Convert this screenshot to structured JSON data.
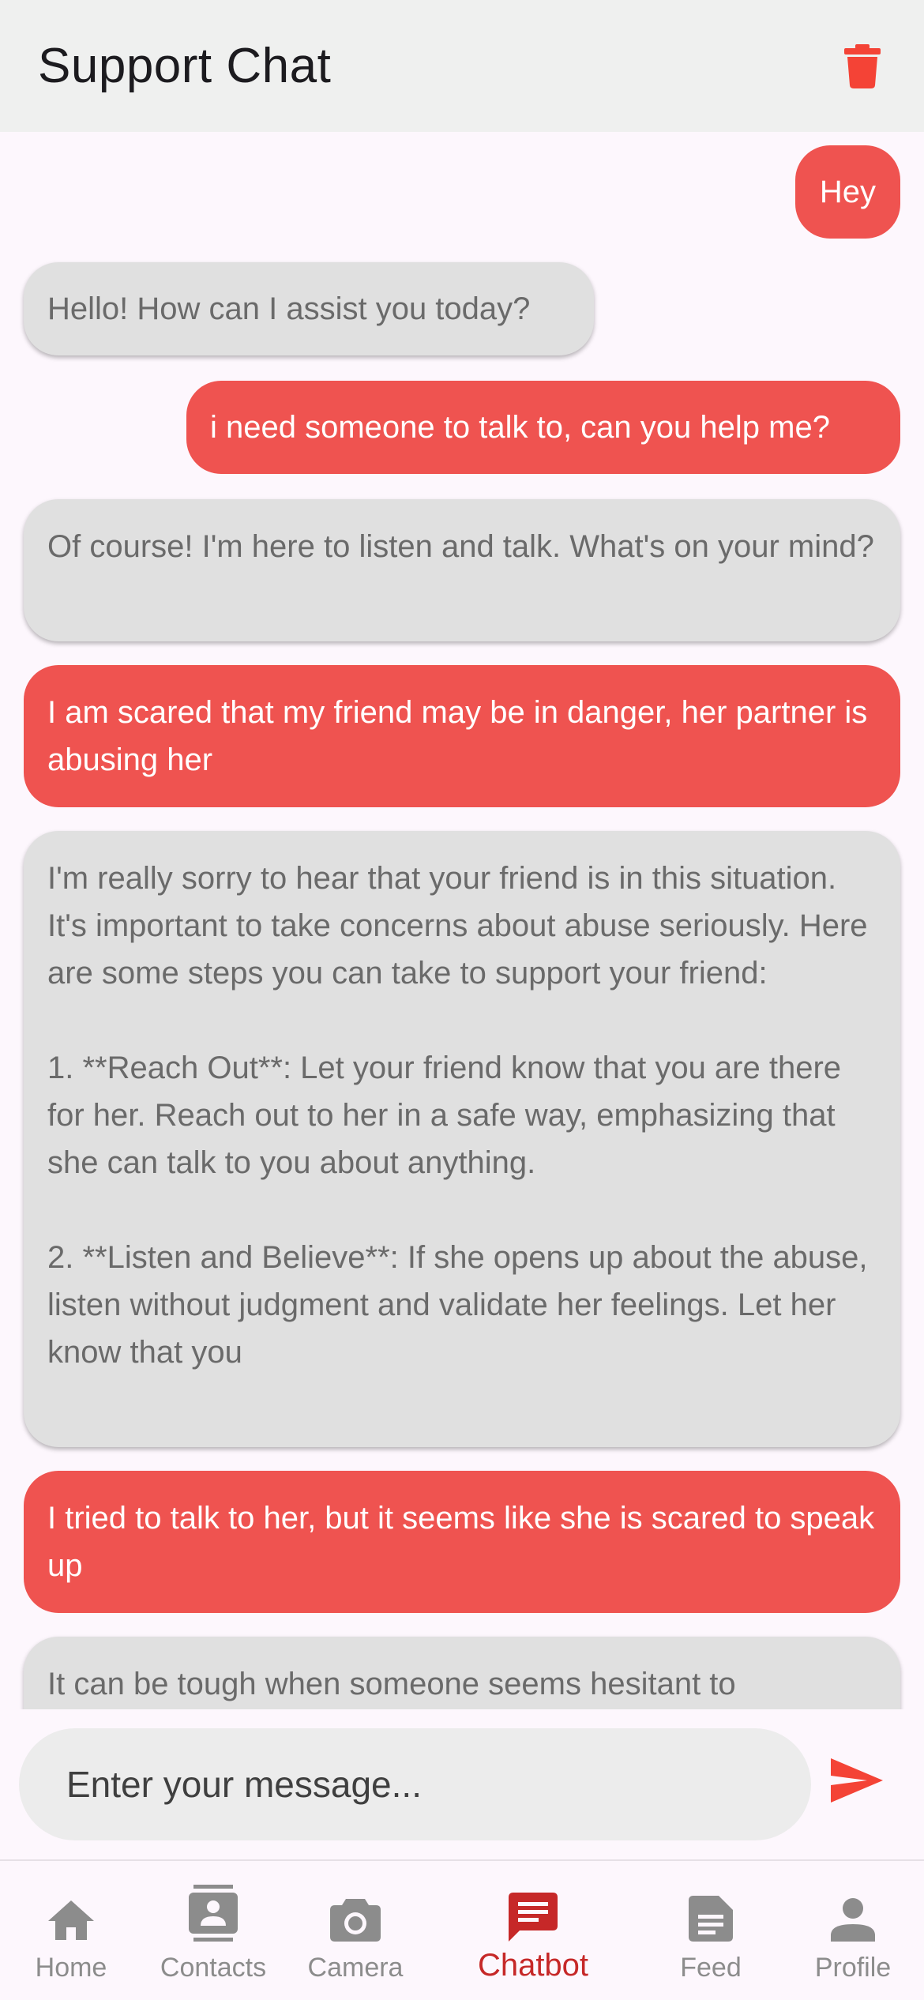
{
  "app_bar": {
    "title": "Support Chat",
    "delete_icon": "trash-icon",
    "accent_color": "#f44336"
  },
  "messages": [
    {
      "sender": "user",
      "text": "Hey"
    },
    {
      "sender": "bot",
      "text": "Hello! How can I assist you today?"
    },
    {
      "sender": "user",
      "text": "i need someone to talk to, can you help me?"
    },
    {
      "sender": "bot",
      "text": "Of course! I'm here to listen and talk. What's on your mind?"
    },
    {
      "sender": "user",
      "text": "I am scared that my friend may be in danger, her partner is abusing her"
    },
    {
      "sender": "bot",
      "text": "I'm really sorry to hear that your friend is in this situation. It's important to take concerns about abuse seriously. Here are some steps you can take to support your friend:\n\n1. **Reach Out**: Let your friend know that you are there for her. Reach out to her in a safe way, emphasizing that she can talk to you about anything.\n\n2. **Listen and Believe**: If she opens up about the abuse, listen without judgment and validate her feelings. Let her know that you"
    },
    {
      "sender": "user",
      "text": "I tried to talk to her, but it seems like she is scared to speak up"
    },
    {
      "sender": "bot",
      "text": "It can be tough when someone seems hesitant to"
    }
  ],
  "composer": {
    "placeholder": "Enter your message...",
    "send_icon": "send-icon"
  },
  "bottom_nav": {
    "active_color": "#c62828",
    "items": [
      {
        "label": "Home",
        "icon": "home-icon"
      },
      {
        "label": "Contacts",
        "icon": "contacts-icon"
      },
      {
        "label": "Camera",
        "icon": "camera-icon"
      },
      {
        "label": "Chatbot",
        "icon": "chat-icon",
        "active": true
      },
      {
        "label": "Feed",
        "icon": "feed-icon"
      },
      {
        "label": "Profile",
        "icon": "person-icon"
      }
    ]
  }
}
